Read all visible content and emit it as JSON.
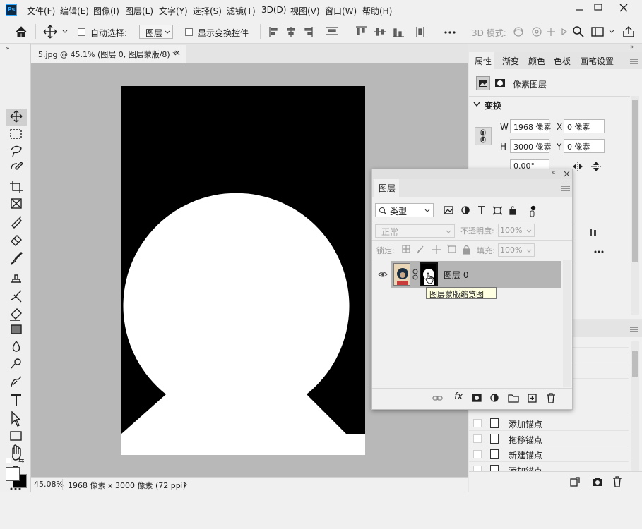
{
  "app": {
    "logo": "Ps"
  },
  "menu": {
    "items": [
      "文件(F)",
      "编辑(E)",
      "图像(I)",
      "图层(L)",
      "文字(Y)",
      "选择(S)",
      "滤镜(T)",
      "3D(D)",
      "视图(V)",
      "窗口(W)",
      "帮助(H)"
    ]
  },
  "options": {
    "auto_select_label": "自动选择:",
    "auto_select_value": "图层",
    "show_transform_label": "显示变换控件",
    "mode_3d_label": "3D 模式:"
  },
  "document": {
    "tab_title": "5.jpg @ 45.1% (图层 0, 图层蒙版/8) *"
  },
  "status": {
    "zoom": "45.08%",
    "info": "1968 像素 x 3000 像素 (72 ppi)"
  },
  "properties": {
    "tabs": [
      "属性",
      "渐变",
      "颜色",
      "色板",
      "画笔设置"
    ],
    "subtitle": "像素图层",
    "section": "变换",
    "w_label": "W",
    "w_value": "1968 像素",
    "h_label": "H",
    "h_value": "3000 像素",
    "x_label": "X",
    "x_value": "0 像素",
    "y_label": "Y",
    "y_value": "0 像素",
    "angle_value": "0.00°"
  },
  "history": {
    "items": [
      "添加锚点",
      "拖移锚点",
      "新建锚点",
      "添加锚点"
    ]
  },
  "layers": {
    "title": "图层",
    "filter_label": "类型",
    "blend_mode": "正常",
    "opacity_label": "不透明度:",
    "opacity_value": "100%",
    "lock_label": "锁定:",
    "fill_label": "填充:",
    "fill_value": "100%",
    "layer_name": "图层 0",
    "tooltip": "图层蒙版缩览图",
    "fx_label": "fx"
  },
  "colors": {
    "accent": "#1473e6",
    "canvas_bg": "#b8b8b8",
    "layer_selected": "#b5b5b5",
    "tooltip_bg": "#ffffe1"
  }
}
